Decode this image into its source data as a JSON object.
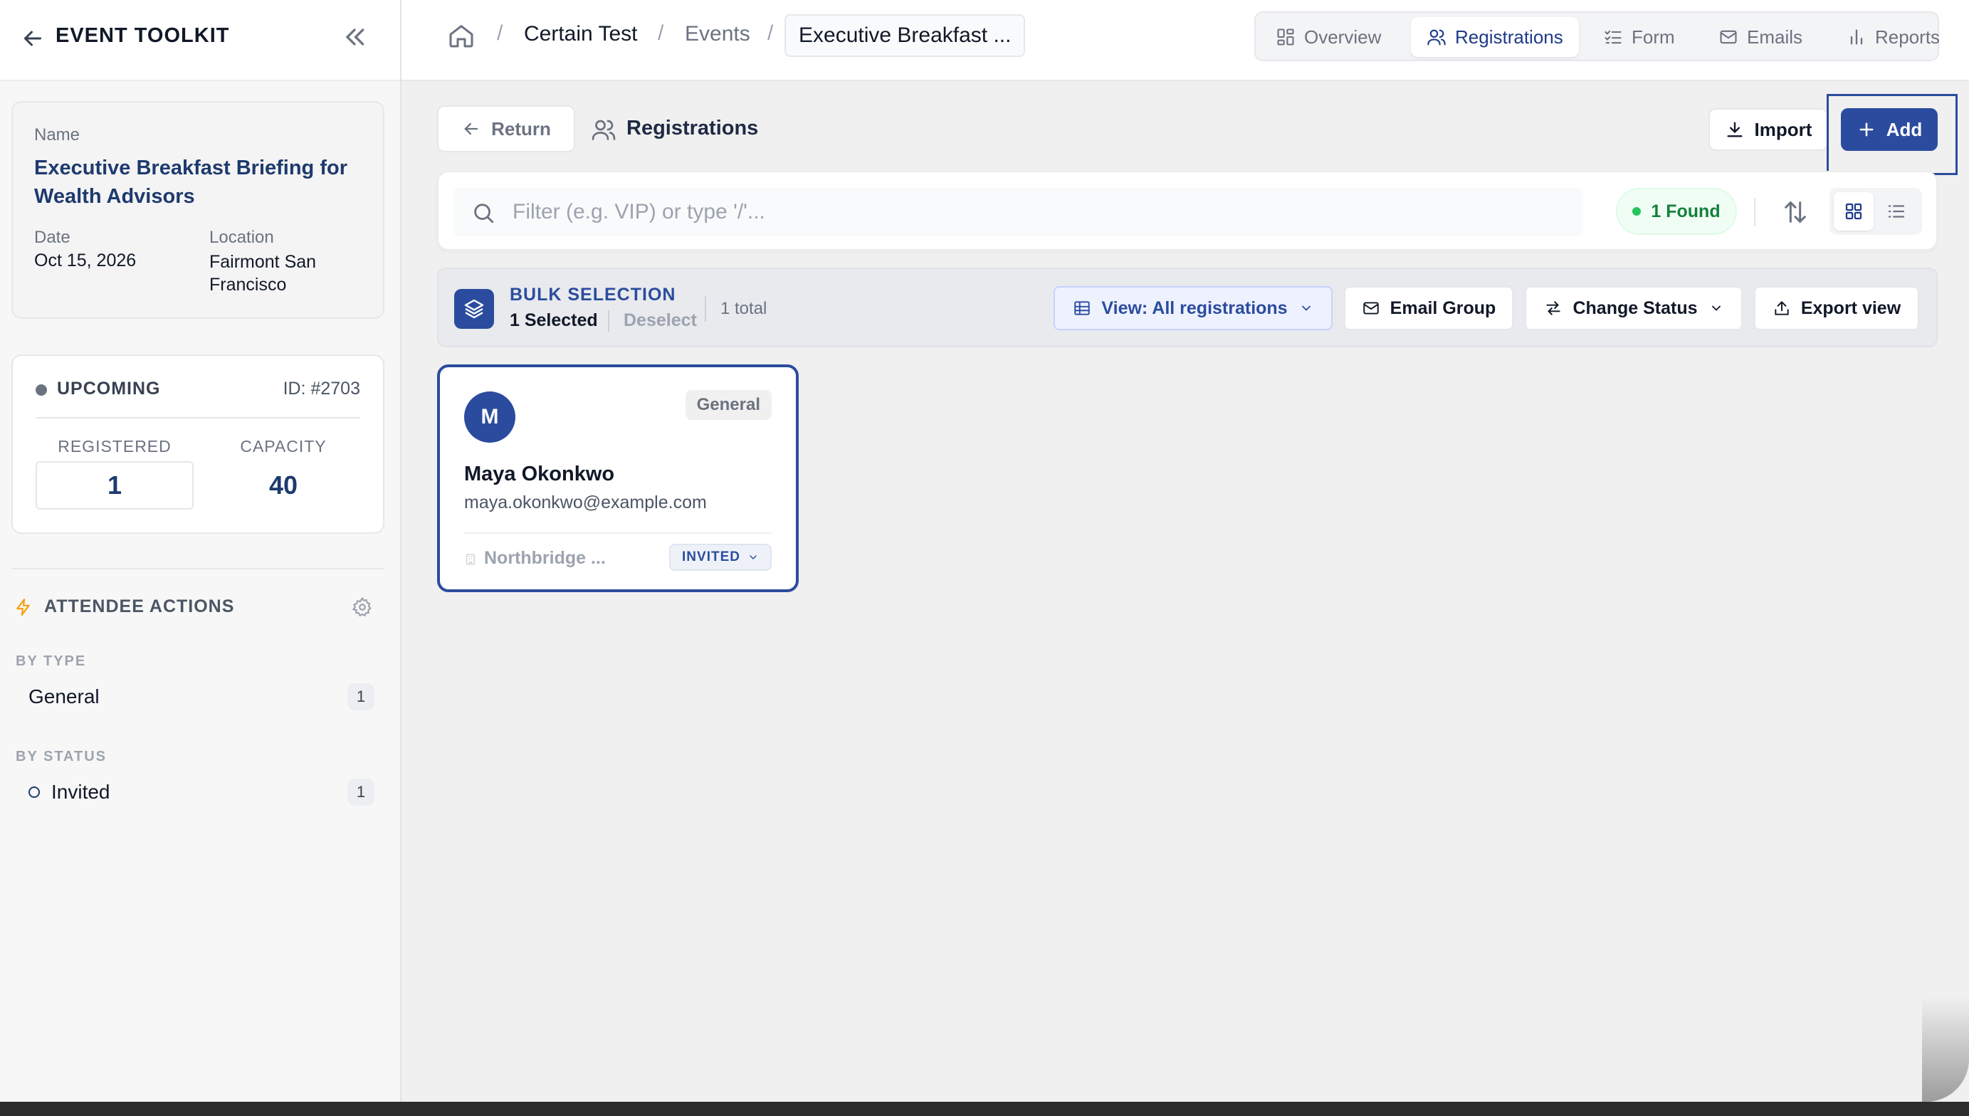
{
  "sidebar": {
    "title": "EVENT TOOLKIT",
    "event": {
      "name_label": "Name",
      "name": "Executive Breakfast Briefing for Wealth Advisors",
      "date_label": "Date",
      "date": "Oct 15, 2026",
      "location_label": "Location",
      "location": "Fairmont San Francisco"
    },
    "stats": {
      "status": "UPCOMING",
      "id": "ID: #2703",
      "registered_label": "REGISTERED",
      "registered": "1",
      "capacity_label": "CAPACITY",
      "capacity": "40"
    },
    "actions": {
      "title": "ATTENDEE ACTIONS",
      "by_type_label": "BY TYPE",
      "types": [
        {
          "label": "General",
          "count": "1"
        }
      ],
      "by_status_label": "BY STATUS",
      "statuses": [
        {
          "label": "Invited",
          "count": "1"
        }
      ]
    }
  },
  "header": {
    "breadcrumbs": [
      "Certain Test",
      "Events",
      "Executive Breakfast ..."
    ],
    "tabs": [
      {
        "label": "Overview",
        "icon": "grid-icon"
      },
      {
        "label": "Registrations",
        "icon": "users-icon",
        "active": true
      },
      {
        "label": "Form",
        "icon": "checklist-icon"
      },
      {
        "label": "Emails",
        "icon": "mail-icon"
      },
      {
        "label": "Reports",
        "icon": "bar-chart-icon"
      }
    ]
  },
  "main": {
    "return_label": "Return",
    "section_title": "Registrations",
    "import_label": "Import",
    "add_label": "Add",
    "search": {
      "placeholder": "Filter (e.g. VIP) or type '/'...",
      "value": ""
    },
    "found_label": "1 Found",
    "bulk": {
      "title": "BULK SELECTION",
      "selected": "1 Selected",
      "deselect": "Deselect",
      "total": "1 total",
      "view_label": "View: All registrations",
      "email_label": "Email Group",
      "status_label": "Change Status",
      "export_label": "Export view"
    },
    "registrations": [
      {
        "initial": "M",
        "type": "General",
        "name": "Maya Okonkwo",
        "email": "maya.okonkwo@example.com",
        "org": "Northbridge ...",
        "status": "INVITED"
      }
    ]
  },
  "colors": {
    "primary": "#2b4c9e",
    "accent_warning": "#f59e0b",
    "success": "#15803d"
  }
}
